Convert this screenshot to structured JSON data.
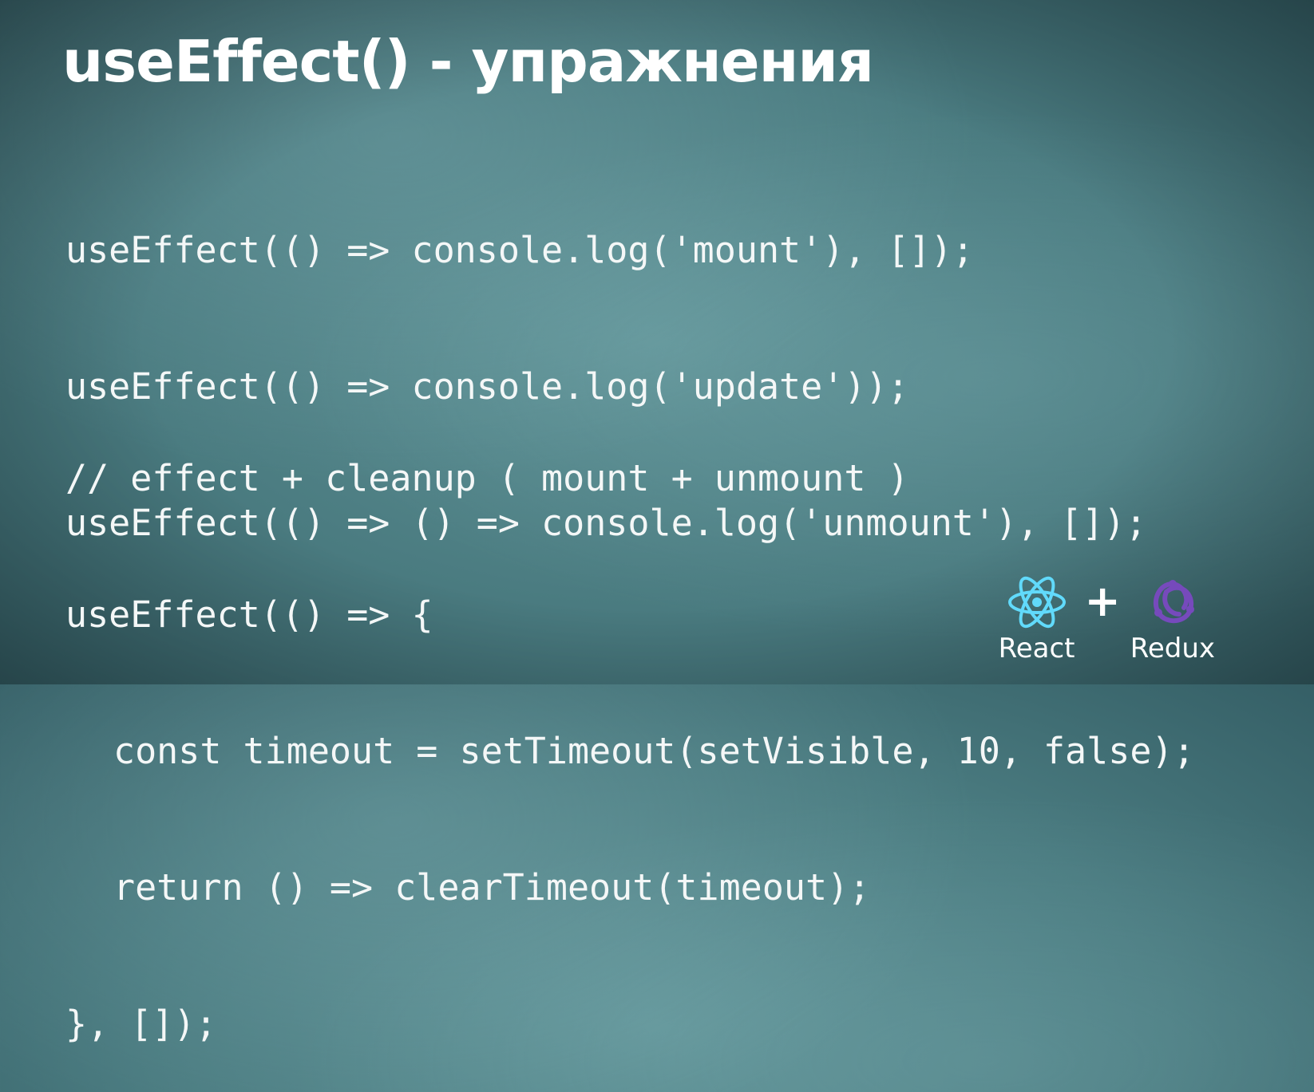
{
  "slide": {
    "title": "useEffect() - упражнения"
  },
  "code": {
    "top_lines": [
      "useEffect(() => console.log('mount'), []);",
      "useEffect(() => console.log('update'));",
      "useEffect(() => () => console.log('unmount'), []);"
    ],
    "bottom_lines": [
      "// effect + cleanup ( mount + unmount )",
      "useEffect(() => {",
      "const timeout = setTimeout(setVisible, 10, false);",
      "return () => clearTimeout(timeout);",
      "}, []);"
    ]
  },
  "logos": {
    "react_label": "React",
    "plus": "+",
    "redux_label": "Redux",
    "react_icon": "react-icon",
    "redux_icon": "redux-icon",
    "react_color": "#61dafb",
    "redux_color": "#764abc"
  }
}
